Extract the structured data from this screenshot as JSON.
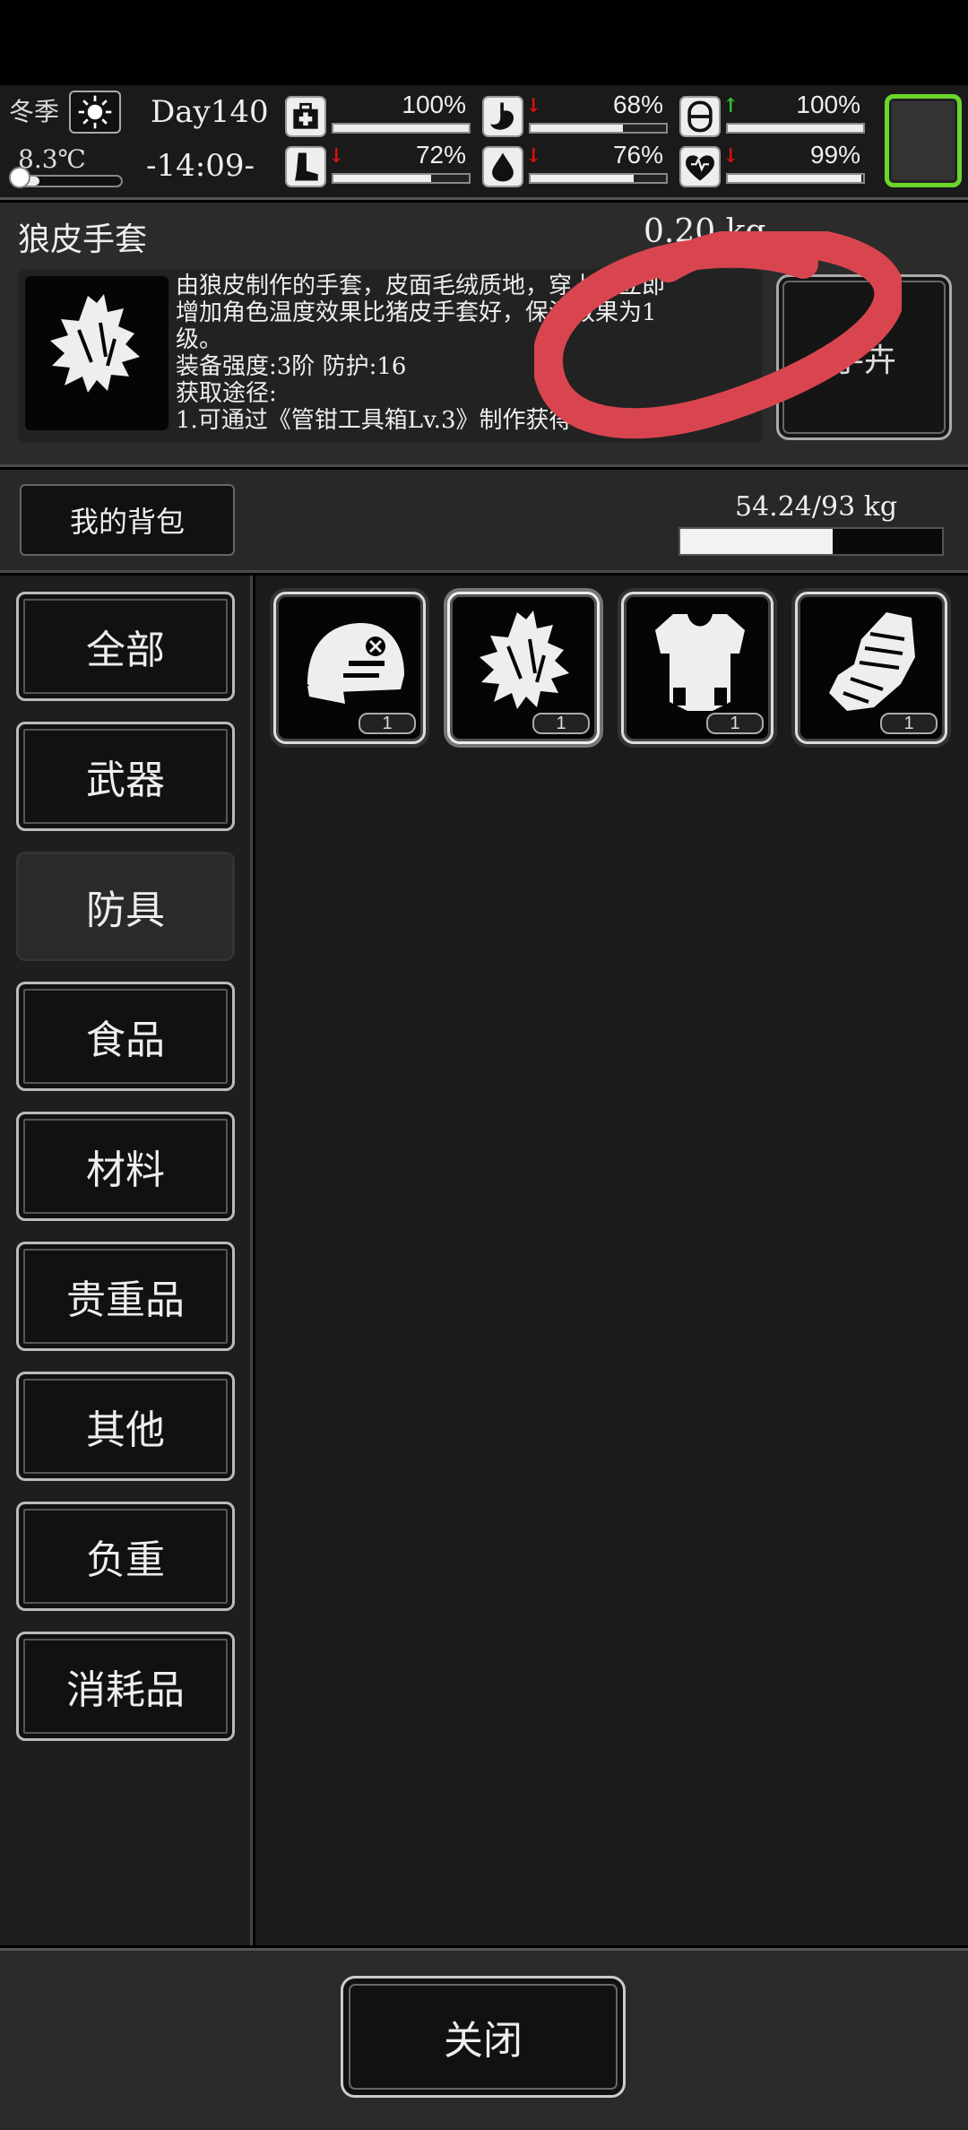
{
  "status": {
    "season": "冬季",
    "temperature": "8.3℃",
    "temperature_level": 0.25,
    "day": "Day140",
    "clock": "-14:09-",
    "stats": [
      {
        "name": "health",
        "icon": "medkit-icon",
        "value": "100%",
        "level": 1.0,
        "trend": ""
      },
      {
        "name": "hunger",
        "icon": "stomach-icon",
        "value": "68%",
        "level": 0.68,
        "trend": "down"
      },
      {
        "name": "energy",
        "icon": "pill-icon",
        "value": "100%",
        "level": 1.0,
        "trend": "up"
      },
      {
        "name": "stamina",
        "icon": "boot-icon",
        "value": "72%",
        "level": 0.72,
        "trend": "down"
      },
      {
        "name": "thirst",
        "icon": "water-drop-icon",
        "value": "76%",
        "level": 0.76,
        "trend": "down"
      },
      {
        "name": "mood",
        "icon": "heart-icon",
        "value": "99%",
        "level": 0.99,
        "trend": "down"
      }
    ],
    "accent_green": "#6bd52a",
    "arrow_down_color": "#e01010",
    "arrow_up_color": "#2ec62e"
  },
  "detail": {
    "name": "狼皮手套",
    "weight": "0.20 kg",
    "desc_lines": [
      "由狼皮制作的手套，皮面毛绒质地，穿上后立即",
      "增加角色温度效果比猪皮手套好，保温效果为1",
      "级。",
      "装备强度:3阶  防护:16",
      "获取途径:",
      "1.可通过《管钳工具箱Lv.3》制作获得"
    ],
    "action_label": "手卉"
  },
  "bag": {
    "title": "我的背包",
    "capacity": "54.24/93 kg",
    "capacity_level": 0.583
  },
  "categories": [
    "全部",
    "武器",
    "防具",
    "食品",
    "材料",
    "贵重品",
    "其他",
    "负重",
    "消耗品"
  ],
  "active_category": "防具",
  "items": [
    {
      "icon": "helmet-icon",
      "qty": "1"
    },
    {
      "icon": "wolf-fur-glove-icon",
      "qty": "1"
    },
    {
      "icon": "body-armor-icon",
      "qty": "1"
    },
    {
      "icon": "armored-gauntlet-icon",
      "qty": "1"
    }
  ],
  "close_label": "关闭"
}
